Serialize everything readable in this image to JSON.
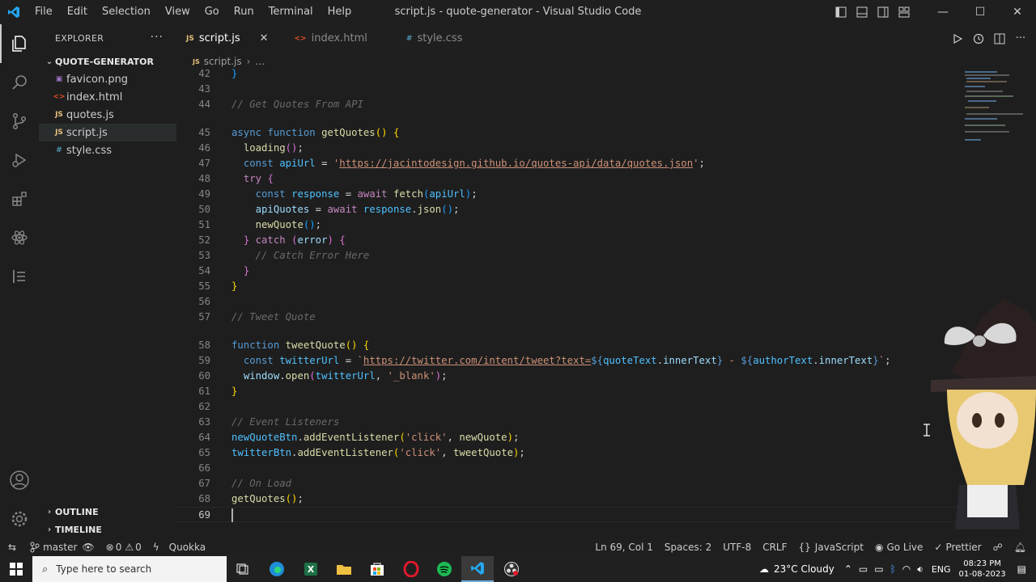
{
  "window": {
    "title": "script.js - quote-generator - Visual Studio Code",
    "menu": [
      "File",
      "Edit",
      "Selection",
      "View",
      "Go",
      "Run",
      "Terminal",
      "Help"
    ]
  },
  "explorer": {
    "header": "EXPLORER",
    "folder": "QUOTE-GENERATOR",
    "files": [
      {
        "name": "favicon.png",
        "icon": "image-icon",
        "glyph": "▣",
        "color": "#a074c4"
      },
      {
        "name": "index.html",
        "icon": "html-icon",
        "glyph": "<>",
        "color": "#e44d26"
      },
      {
        "name": "quotes.js",
        "icon": "js-icon",
        "glyph": "JS",
        "color": "#e5c07b"
      },
      {
        "name": "script.js",
        "icon": "js-icon",
        "glyph": "JS",
        "color": "#e5c07b"
      },
      {
        "name": "style.css",
        "icon": "css-icon",
        "glyph": "#",
        "color": "#519aba"
      }
    ],
    "selected_file": "script.js",
    "outline": "OUTLINE",
    "timeline": "TIMELINE"
  },
  "tabs": [
    {
      "label": "script.js",
      "icon": "JS",
      "color": "#e5c07b",
      "active": true
    },
    {
      "label": "index.html",
      "icon": "<>",
      "color": "#e44d26",
      "active": false
    },
    {
      "label": "style.css",
      "icon": "#",
      "color": "#519aba",
      "active": false
    }
  ],
  "breadcrumb": {
    "file": "script.js",
    "rest": "…"
  },
  "editor": {
    "current_line": 69,
    "line_numbers": [
      "42",
      "43",
      "44",
      "45",
      "46",
      "47",
      "48",
      "49",
      "50",
      "51",
      "52",
      "53",
      "54",
      "55",
      "56",
      "57",
      "58",
      "59",
      "60",
      "61",
      "62",
      "63",
      "64",
      "65",
      "66",
      "67",
      "68",
      "69"
    ],
    "tokens": {
      "l42": "}",
      "l44": "// Get Quotes From API",
      "l45_kw": "async",
      "l45_fn": "function",
      "l45_name": "getQuotes",
      "l46": "loading",
      "l47_kw": "const",
      "l47_var": "apiUrl",
      "l47_url": "https://jacintodesign.github.io/quotes-api/data/quotes.json",
      "l48": "try",
      "l49_kw": "const",
      "l49_var": "response",
      "l49_await": "await",
      "l49_fetch": "fetch",
      "l49_arg": "apiUrl",
      "l50_var": "apiQuotes",
      "l50_await": "await",
      "l50_obj": "response",
      "l50_fn": "json",
      "l51": "newQuote",
      "l52_catch": "catch",
      "l52_err": "error",
      "l53": "// Catch Error Here",
      "l57": "// Tweet Quote",
      "l58_fn": "function",
      "l58_name": "tweetQuote",
      "l59_kw": "const",
      "l59_var": "twitterUrl",
      "l59_url": "https://twitter.com/intent/tweet?text=",
      "l59_q": "quoteText",
      "l59_prop": "innerText",
      "l59_dash": " - ",
      "l59_a": "authorText",
      "l59_prop2": "innerText",
      "l60_obj": "window",
      "l60_fn": "open",
      "l60_arg": "twitterUrl",
      "l60_str": "'_blank'",
      "l63": "// Event Listeners",
      "l64_obj": "newQuoteBtn",
      "l64_fn": "addEventListener",
      "l64_str": "'click'",
      "l64_arg": "newQuote",
      "l65_obj": "twitterBtn",
      "l65_fn": "addEventListener",
      "l65_str": "'click'",
      "l65_arg": "tweetQuote",
      "l67": "// On Load",
      "l68": "getQuotes"
    }
  },
  "statusbar": {
    "branch": "master",
    "errors": "0",
    "warnings": "0",
    "quokka": "Quokka",
    "position": "Ln 69, Col 1",
    "spaces": "Spaces: 2",
    "encoding": "UTF-8",
    "eol": "CRLF",
    "language": "JavaScript",
    "golive": "Go Live",
    "prettier": "Prettier"
  },
  "taskbar": {
    "search_placeholder": "Type here to search",
    "weather": "23°C  Cloudy",
    "lang": "ENG",
    "time": "08:23 PM",
    "date": "01-08-2023"
  },
  "colors": {
    "accent": "#007acc",
    "background": "#1e1e1e"
  }
}
